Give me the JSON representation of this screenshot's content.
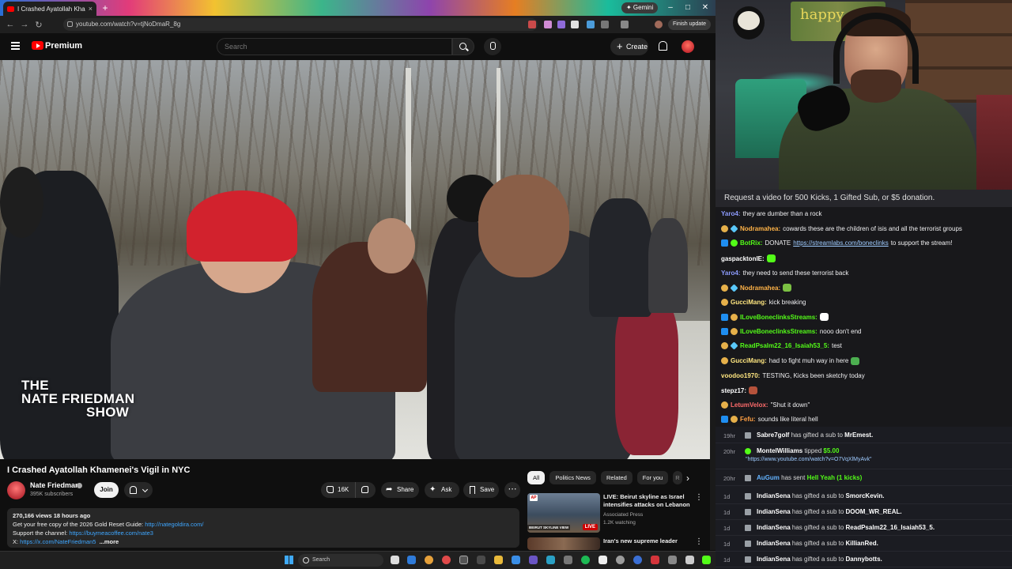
{
  "browser": {
    "tab_title": "I Crashed Ayatollah Khame",
    "tab_close": "×",
    "new_tab": "+",
    "gemini_label": "✦ Gemini",
    "url": "youtube.com/watch?v=tjNoDmaR_8g",
    "finish_update": "Finish update",
    "back": "←",
    "forward": "→",
    "reload": "↻",
    "minimize": "–",
    "maximize": "□",
    "close": "✕"
  },
  "youtube": {
    "brand": "Premium",
    "search_placeholder": "Search",
    "create_label": "Create",
    "video_title": "I Crashed Ayatollah Khamenei's Vigil in NYC",
    "watermark_line1": "THE",
    "watermark_line2": "NATE FRIEDMAN",
    "watermark_line3": "SHOW",
    "channel": {
      "name": "Nate Friedman",
      "subscribers": "395K subscribers",
      "join": "Join"
    },
    "actions": {
      "likes": "16K",
      "share": "Share",
      "ask": "Ask",
      "save": "Save",
      "more": "⋯"
    },
    "description": {
      "stats": "270,166 views  18 hours ago",
      "line1_text": "Get your free copy of the 2026 Gold Reset Guide: ",
      "line1_link": "http://nategoldira.com/",
      "line2_text": "Support the channel: ",
      "line2_link": "https://buymeacoffee.com/nate3",
      "line3_text": "X: ",
      "line3_link": "https://x.com/NateFriedman5",
      "more": "...more"
    },
    "chips": [
      "All",
      "Politics News",
      "Related",
      "For you",
      "R"
    ],
    "chip_next": "›",
    "related": [
      {
        "title": "LIVE: Beirut skyline as Israel intensifies attacks on Lebanon",
        "channel": "Associated Press",
        "meta": "1.2K watching",
        "badge": "LIVE",
        "thumb_label": "BEIRUT SKYLINE VIEW"
      },
      {
        "title": "Iran's new supreme leader"
      }
    ]
  },
  "taskbar": {
    "search": "Search"
  },
  "stream": {
    "sign_text": "happy",
    "banner": "Request a video for 500 Kicks, 1 Gifted Sub, or $5 donation."
  },
  "chat": [
    {
      "user": "Yaro4",
      "color": "#8e9cff",
      "text": "they are dumber than a rock",
      "badges": []
    },
    {
      "user": "Nodramahea",
      "color": "#ffb347",
      "text": "cowards these are the children of isis and all the terrorist groups",
      "badges": [
        "gift",
        "gem"
      ]
    },
    {
      "user": "BotRix",
      "color": "#53fc18",
      "text": "DONATE ",
      "link": "https://streamlabs.com/boneclinks",
      "tail": " to support the stream!",
      "badges": [
        "kick",
        "green"
      ]
    },
    {
      "user": "gaspacktonIE",
      "color": "#ffffff",
      "text": "",
      "emote": "#53fc18",
      "badges": []
    },
    {
      "user": "Yaro4",
      "color": "#8e9cff",
      "text": "they need to send these terrorist back",
      "badges": []
    },
    {
      "user": "Nodramahea",
      "color": "#ffb347",
      "text": "",
      "emote": "#7bc043",
      "badges": [
        "gift",
        "gem"
      ]
    },
    {
      "user": "GucciMang",
      "color": "#ffe680",
      "text": "kick breaking",
      "badges": [
        "gift"
      ]
    },
    {
      "user": "ILoveBoneclinksStreams",
      "color": "#53fc18",
      "text": "",
      "emote": "#ffffff",
      "badges": [
        "kick",
        "gift"
      ]
    },
    {
      "user": "ILoveBoneclinksStreams",
      "color": "#53fc18",
      "text": "nooo don't end",
      "badges": [
        "kick",
        "gift"
      ]
    },
    {
      "user": "ReadPsalm22_16_Isaiah53_5",
      "color": "#53fc18",
      "text": "test",
      "badges": [
        "gift",
        "gem"
      ]
    },
    {
      "user": "GucciMang",
      "color": "#ffe680",
      "text": "had to fight muh way in here",
      "emote": "#4caf50",
      "badges": [
        "gift"
      ]
    },
    {
      "user": "voodoo1970",
      "color": "#ffe680",
      "text": "TESTING, Kicks been sketchy today",
      "badges": []
    },
    {
      "user": "stepz17",
      "color": "#ffffff",
      "text": "",
      "emote": "#b5523b",
      "badges": []
    },
    {
      "user": "LetumVelox",
      "color": "#ff6b6b",
      "text": "\"Shut it down\"",
      "badges": [
        "gift"
      ]
    },
    {
      "user": "Fefu",
      "color": "#ff9f43",
      "text": "sounds like literal hell",
      "badges": [
        "kick",
        "gift"
      ]
    }
  ],
  "events": [
    {
      "time": "19hr",
      "user": "Sabre7golf",
      "text": " has gifted a sub to ",
      "target": "MrEmest."
    },
    {
      "time": "20hr",
      "user": "MontelWilliams",
      "text": " tipped ",
      "target": "$5.00",
      "link": "\"https://www.youtube.com/watch?v=O7VqXlMyAvk\""
    },
    {
      "time": "20hr",
      "user": "AuGum",
      "text": " has sent ",
      "target": "Hell Yeah (1 kicks)"
    },
    {
      "time": "1d",
      "user": "IndianSena",
      "text": " has gifted a sub to ",
      "target": "SmorcKevin."
    },
    {
      "time": "1d",
      "user": "IndianSena",
      "text": " has gifted a sub to ",
      "target": "DOOM_WR_REAL."
    },
    {
      "time": "1d",
      "user": "IndianSena",
      "text": " has gifted a sub to ",
      "target": "ReadPsalm22_16_Isaiah53_5."
    },
    {
      "time": "1d",
      "user": "IndianSena",
      "text": " has gifted a sub to ",
      "target": "KillianRed."
    },
    {
      "time": "1d",
      "user": "IndianSena",
      "text": " has gifted a sub to ",
      "target": "Dannybotts."
    }
  ],
  "colors": {
    "youtube_red": "#ff0000",
    "link_blue": "#3ea6ff",
    "kick_green": "#53fc18",
    "chat_bg": "#18181b"
  }
}
